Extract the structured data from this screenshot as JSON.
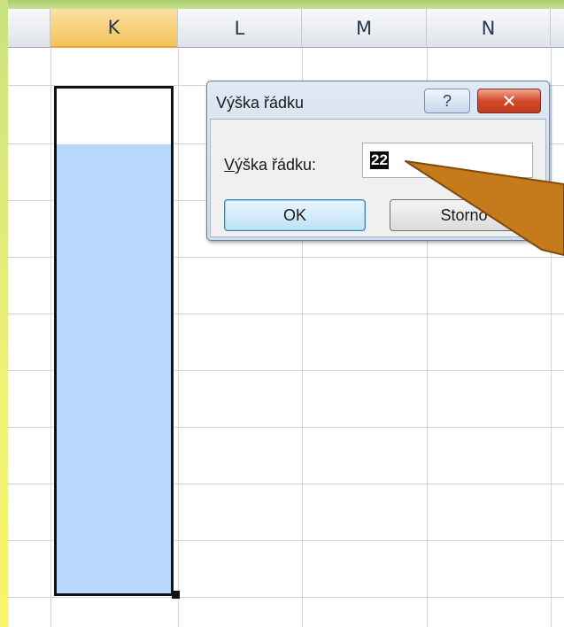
{
  "columns": [
    "K",
    "L",
    "M",
    "N"
  ],
  "dialog": {
    "title": "Výška řádku",
    "help_label": "?",
    "close_label": "✕",
    "field_label_underlined": "V",
    "field_label_rest": "ýška řádku:",
    "field_value": "22",
    "ok_label": "OK",
    "cancel_label": "Storno"
  },
  "colors": {
    "selection_fill": "#b7d8fb",
    "callout_arrow": "#c57a1c",
    "frame_green": "#a9cf6c"
  }
}
